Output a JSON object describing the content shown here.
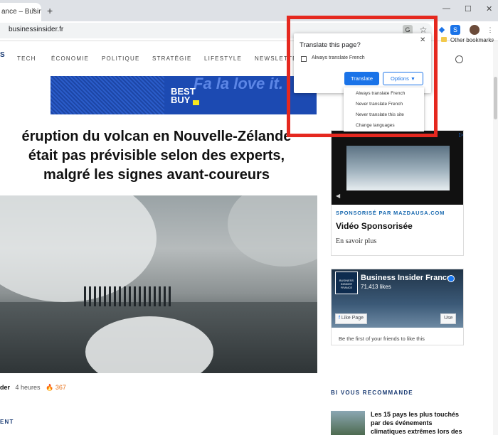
{
  "browser": {
    "tab_title": "ance – Busine",
    "tab_close": "×",
    "new_tab": "+",
    "window_controls": [
      "—",
      "☐",
      "✕"
    ],
    "url": "businessinsider.fr",
    "bookmarks_label": "Other bookmarks"
  },
  "site": {
    "logo_fragment": "S",
    "nav": [
      "TECH",
      "ÉCONOMIE",
      "POLITIQUE",
      "STRATÉGIE",
      "LIFESTYLE",
      "NEWSLETTE"
    ],
    "ad_brand": "BEST BUY",
    "ad_slogan": "Fa la love it."
  },
  "article": {
    "headline_lines": [
      "éruption du volcan en Nouvelle-Zélande",
      "était pas prévisible selon des experts,",
      "malgré les signes avant-coureurs"
    ],
    "author_fragment": "der",
    "time": "4 heures",
    "shares": "367",
    "section_label": "ENT"
  },
  "sidebar": {
    "sponsored_label": "SPONSORISÉ PAR MAZDAUSA.COM",
    "video_title": "Vidéo Sponsorisée",
    "read_more": "En savoir plus",
    "fb_logo_text": "BUSINESS INSIDER FRANCE",
    "fb_page_name": "Business Insider France",
    "fb_likes": "71,413 likes",
    "fb_like_button": "Like Page",
    "fb_use_button": "Use",
    "fb_friends": "Be the first of your friends to like this",
    "recommends_label": "BI VOUS RECOMMANDE",
    "rec_article": "Les 15 pays les plus touchés par des événements climatiques extrêmes lors des"
  },
  "translate_popup": {
    "title": "Translate this page?",
    "always_translate": "Always translate French",
    "translate_button": "Translate",
    "options_button": "Options",
    "options_menu": [
      "Always translate French",
      "Never translate French",
      "Never translate this site",
      "Change languages"
    ]
  }
}
